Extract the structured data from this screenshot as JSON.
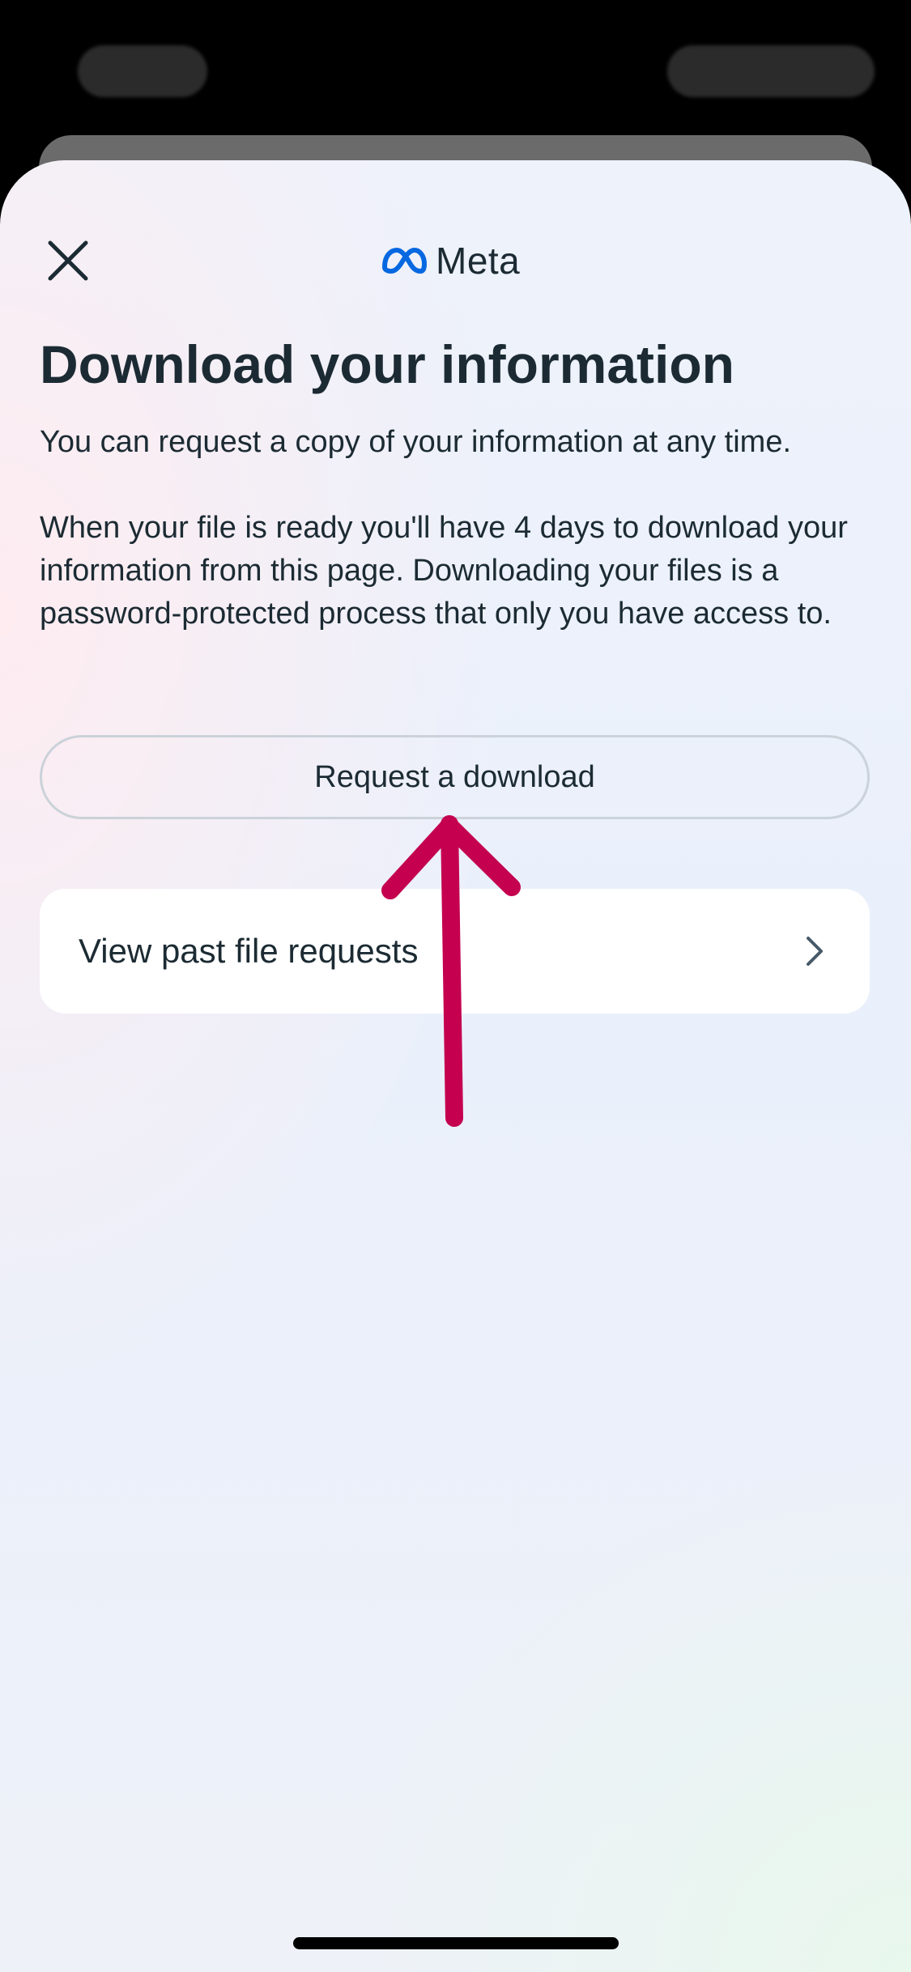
{
  "header": {
    "close_icon": "close-icon",
    "logo_text": "Meta",
    "logo_icon": "meta-infinity-icon",
    "logo_color": "#0668E1"
  },
  "main": {
    "title": "Download your information",
    "intro": "You can request a copy of your information at any time.",
    "details": "When your file is ready you'll have 4 days to download your information from this page. Downloading your files is a password-protected process that only you have access to.",
    "request_button_label": "Request a download",
    "past_requests_label": "View past file requests",
    "past_requests_icon": "chevron-right-icon"
  },
  "annotation": {
    "type": "arrow-up",
    "color": "#C4004F"
  },
  "colors": {
    "text": "#1c2b33",
    "button_border": "#cbd2d9",
    "card_background": "#ffffff"
  }
}
